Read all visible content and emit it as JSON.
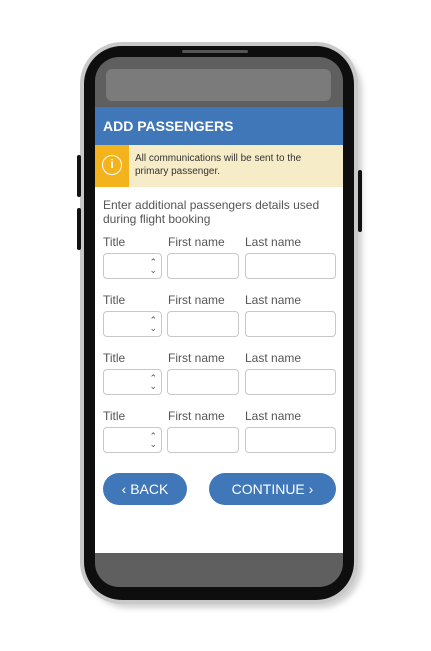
{
  "header": {
    "title": "ADD PASSENGERS"
  },
  "notice": {
    "text": "All communications will be sent to the primary passenger.",
    "icon": "info-icon"
  },
  "intro": "Enter additional passengers details used during flight booking",
  "labels": {
    "title": "Title",
    "first_name": "First name",
    "last_name": "Last name"
  },
  "passenger_rows": [
    {
      "title": "",
      "first_name": "",
      "last_name": ""
    },
    {
      "title": "",
      "first_name": "",
      "last_name": ""
    },
    {
      "title": "",
      "first_name": "",
      "last_name": ""
    },
    {
      "title": "",
      "first_name": "",
      "last_name": ""
    }
  ],
  "buttons": {
    "back_label": "BACK",
    "continue_label": "CONTINUE"
  },
  "colors": {
    "primary": "#3f77b8",
    "notice_bg": "#f6ecc8",
    "notice_accent": "#f2b31d"
  }
}
